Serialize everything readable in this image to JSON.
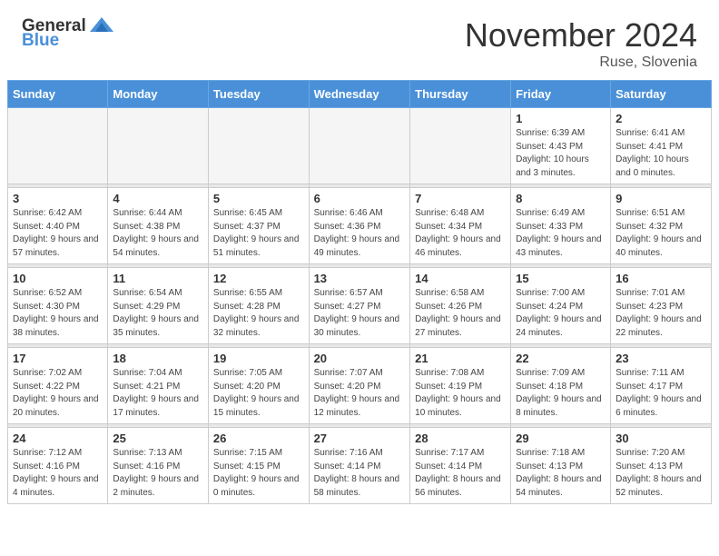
{
  "header": {
    "logo_general": "General",
    "logo_blue": "Blue",
    "month_title": "November 2024",
    "location": "Ruse, Slovenia"
  },
  "days_of_week": [
    "Sunday",
    "Monday",
    "Tuesday",
    "Wednesday",
    "Thursday",
    "Friday",
    "Saturday"
  ],
  "weeks": [
    [
      {
        "day": "",
        "info": ""
      },
      {
        "day": "",
        "info": ""
      },
      {
        "day": "",
        "info": ""
      },
      {
        "day": "",
        "info": ""
      },
      {
        "day": "",
        "info": ""
      },
      {
        "day": "1",
        "info": "Sunrise: 6:39 AM\nSunset: 4:43 PM\nDaylight: 10 hours and 3 minutes."
      },
      {
        "day": "2",
        "info": "Sunrise: 6:41 AM\nSunset: 4:41 PM\nDaylight: 10 hours and 0 minutes."
      }
    ],
    [
      {
        "day": "3",
        "info": "Sunrise: 6:42 AM\nSunset: 4:40 PM\nDaylight: 9 hours and 57 minutes."
      },
      {
        "day": "4",
        "info": "Sunrise: 6:44 AM\nSunset: 4:38 PM\nDaylight: 9 hours and 54 minutes."
      },
      {
        "day": "5",
        "info": "Sunrise: 6:45 AM\nSunset: 4:37 PM\nDaylight: 9 hours and 51 minutes."
      },
      {
        "day": "6",
        "info": "Sunrise: 6:46 AM\nSunset: 4:36 PM\nDaylight: 9 hours and 49 minutes."
      },
      {
        "day": "7",
        "info": "Sunrise: 6:48 AM\nSunset: 4:34 PM\nDaylight: 9 hours and 46 minutes."
      },
      {
        "day": "8",
        "info": "Sunrise: 6:49 AM\nSunset: 4:33 PM\nDaylight: 9 hours and 43 minutes."
      },
      {
        "day": "9",
        "info": "Sunrise: 6:51 AM\nSunset: 4:32 PM\nDaylight: 9 hours and 40 minutes."
      }
    ],
    [
      {
        "day": "10",
        "info": "Sunrise: 6:52 AM\nSunset: 4:30 PM\nDaylight: 9 hours and 38 minutes."
      },
      {
        "day": "11",
        "info": "Sunrise: 6:54 AM\nSunset: 4:29 PM\nDaylight: 9 hours and 35 minutes."
      },
      {
        "day": "12",
        "info": "Sunrise: 6:55 AM\nSunset: 4:28 PM\nDaylight: 9 hours and 32 minutes."
      },
      {
        "day": "13",
        "info": "Sunrise: 6:57 AM\nSunset: 4:27 PM\nDaylight: 9 hours and 30 minutes."
      },
      {
        "day": "14",
        "info": "Sunrise: 6:58 AM\nSunset: 4:26 PM\nDaylight: 9 hours and 27 minutes."
      },
      {
        "day": "15",
        "info": "Sunrise: 7:00 AM\nSunset: 4:24 PM\nDaylight: 9 hours and 24 minutes."
      },
      {
        "day": "16",
        "info": "Sunrise: 7:01 AM\nSunset: 4:23 PM\nDaylight: 9 hours and 22 minutes."
      }
    ],
    [
      {
        "day": "17",
        "info": "Sunrise: 7:02 AM\nSunset: 4:22 PM\nDaylight: 9 hours and 20 minutes."
      },
      {
        "day": "18",
        "info": "Sunrise: 7:04 AM\nSunset: 4:21 PM\nDaylight: 9 hours and 17 minutes."
      },
      {
        "day": "19",
        "info": "Sunrise: 7:05 AM\nSunset: 4:20 PM\nDaylight: 9 hours and 15 minutes."
      },
      {
        "day": "20",
        "info": "Sunrise: 7:07 AM\nSunset: 4:20 PM\nDaylight: 9 hours and 12 minutes."
      },
      {
        "day": "21",
        "info": "Sunrise: 7:08 AM\nSunset: 4:19 PM\nDaylight: 9 hours and 10 minutes."
      },
      {
        "day": "22",
        "info": "Sunrise: 7:09 AM\nSunset: 4:18 PM\nDaylight: 9 hours and 8 minutes."
      },
      {
        "day": "23",
        "info": "Sunrise: 7:11 AM\nSunset: 4:17 PM\nDaylight: 9 hours and 6 minutes."
      }
    ],
    [
      {
        "day": "24",
        "info": "Sunrise: 7:12 AM\nSunset: 4:16 PM\nDaylight: 9 hours and 4 minutes."
      },
      {
        "day": "25",
        "info": "Sunrise: 7:13 AM\nSunset: 4:16 PM\nDaylight: 9 hours and 2 minutes."
      },
      {
        "day": "26",
        "info": "Sunrise: 7:15 AM\nSunset: 4:15 PM\nDaylight: 9 hours and 0 minutes."
      },
      {
        "day": "27",
        "info": "Sunrise: 7:16 AM\nSunset: 4:14 PM\nDaylight: 8 hours and 58 minutes."
      },
      {
        "day": "28",
        "info": "Sunrise: 7:17 AM\nSunset: 4:14 PM\nDaylight: 8 hours and 56 minutes."
      },
      {
        "day": "29",
        "info": "Sunrise: 7:18 AM\nSunset: 4:13 PM\nDaylight: 8 hours and 54 minutes."
      },
      {
        "day": "30",
        "info": "Sunrise: 7:20 AM\nSunset: 4:13 PM\nDaylight: 8 hours and 52 minutes."
      }
    ]
  ]
}
